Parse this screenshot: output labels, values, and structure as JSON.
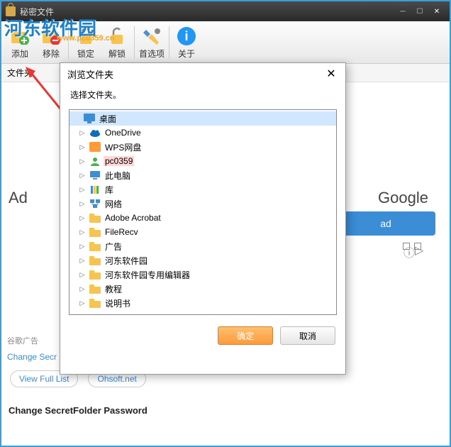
{
  "window": {
    "title": "秘密文件"
  },
  "watermark": {
    "text1": "河东软件园",
    "url": "www.pc0359.cn"
  },
  "toolbar": {
    "add": "添加",
    "remove": "移除",
    "lock": "锁定",
    "unlock": "解锁",
    "prefs": "首选项",
    "about": "关于"
  },
  "header": {
    "folder_col": "文件夹"
  },
  "bg": {
    "ad_left": "Ad",
    "google": "Google",
    "ad_btn": "ad",
    "ad_label": "谷歌广告",
    "change": "Change Secr",
    "view_full": "View Full List",
    "ohsoft": "Ohsoft.net",
    "pw_label": "Change SecretFolder Password"
  },
  "dialog": {
    "title": "浏览文件夹",
    "prompt": "选择文件夹。",
    "ok": "确定",
    "cancel": "取消",
    "tree": {
      "root": "桌面",
      "items": [
        {
          "name": "OneDrive",
          "icon": "cloud"
        },
        {
          "name": "WPS网盘",
          "icon": "wps"
        },
        {
          "name": "pc0359",
          "icon": "user",
          "selected": true
        },
        {
          "name": "此电脑",
          "icon": "pc"
        },
        {
          "name": "库",
          "icon": "lib"
        },
        {
          "name": "网络",
          "icon": "net"
        },
        {
          "name": "Adobe Acrobat",
          "icon": "folder"
        },
        {
          "name": "FileRecv",
          "icon": "folder"
        },
        {
          "name": "广告",
          "icon": "folder"
        },
        {
          "name": "河东软件园",
          "icon": "folder"
        },
        {
          "name": "河东软件园专用编辑器",
          "icon": "folder"
        },
        {
          "name": "教程",
          "icon": "folder"
        },
        {
          "name": "说明书",
          "icon": "folder"
        }
      ]
    }
  }
}
